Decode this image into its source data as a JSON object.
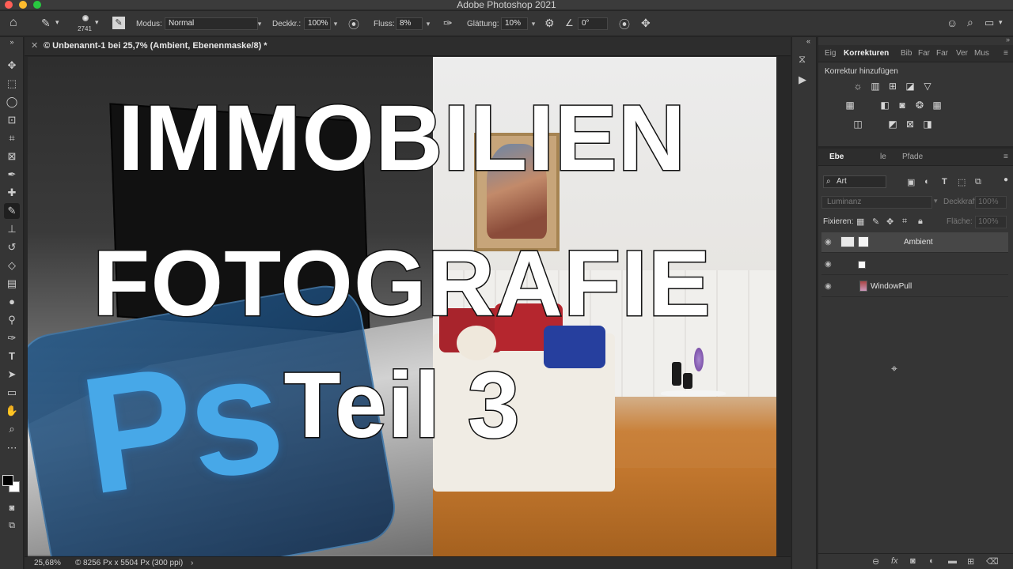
{
  "window": {
    "title": "Adobe Photoshop 2021"
  },
  "options_bar": {
    "brush_size": "2741",
    "mode_label": "Modus:",
    "mode_value": "Normal",
    "opacity_label": "Deckkr.:",
    "opacity_value": "100%",
    "flow_label": "Fluss:",
    "flow_value": "8%",
    "smoothing_label": "Glättung:",
    "smoothing_value": "10%",
    "angle_value": "0°"
  },
  "document": {
    "tab_title": "© Unbenannt-1 bei 25,7% (Ambient, Ebenenmaske/8) *",
    "headline_1": "IMMOBILIEN",
    "headline_2": "FOTOGRAFIE",
    "headline_3": "Teil 3",
    "ps_logo": "Ps"
  },
  "status_bar": {
    "zoom": "25,68%",
    "dimensions": "8256 Px x 5504 Px (300 ppi)"
  },
  "panels": {
    "adjustments_tabs": [
      "Eig",
      "Korrekturen",
      "Bib",
      "Far",
      "Far",
      "Ver",
      "Mus"
    ],
    "active_adjustments_tab": "Korrekturen",
    "add_adjustment_label": "Korrektur hinzufügen",
    "layers_tabs": [
      "Ebe",
      "le",
      "Pfade"
    ],
    "filter_kind": "Art",
    "blend_mode": "Luminanz",
    "opacity_label": "Deckkraft:",
    "opacity_value": "100%",
    "lock_label": "Fixieren:",
    "fill_label": "Fläche:",
    "fill_value": "100%",
    "layers": [
      {
        "name": "Ambient",
        "selected": true
      },
      {
        "name": "",
        "selected": false
      },
      {
        "name": "WindowPull",
        "selected": false
      }
    ]
  },
  "colors": {
    "accent_blue": "#47a8e8",
    "panel_bg": "#353535",
    "app_bg": "#262626"
  }
}
